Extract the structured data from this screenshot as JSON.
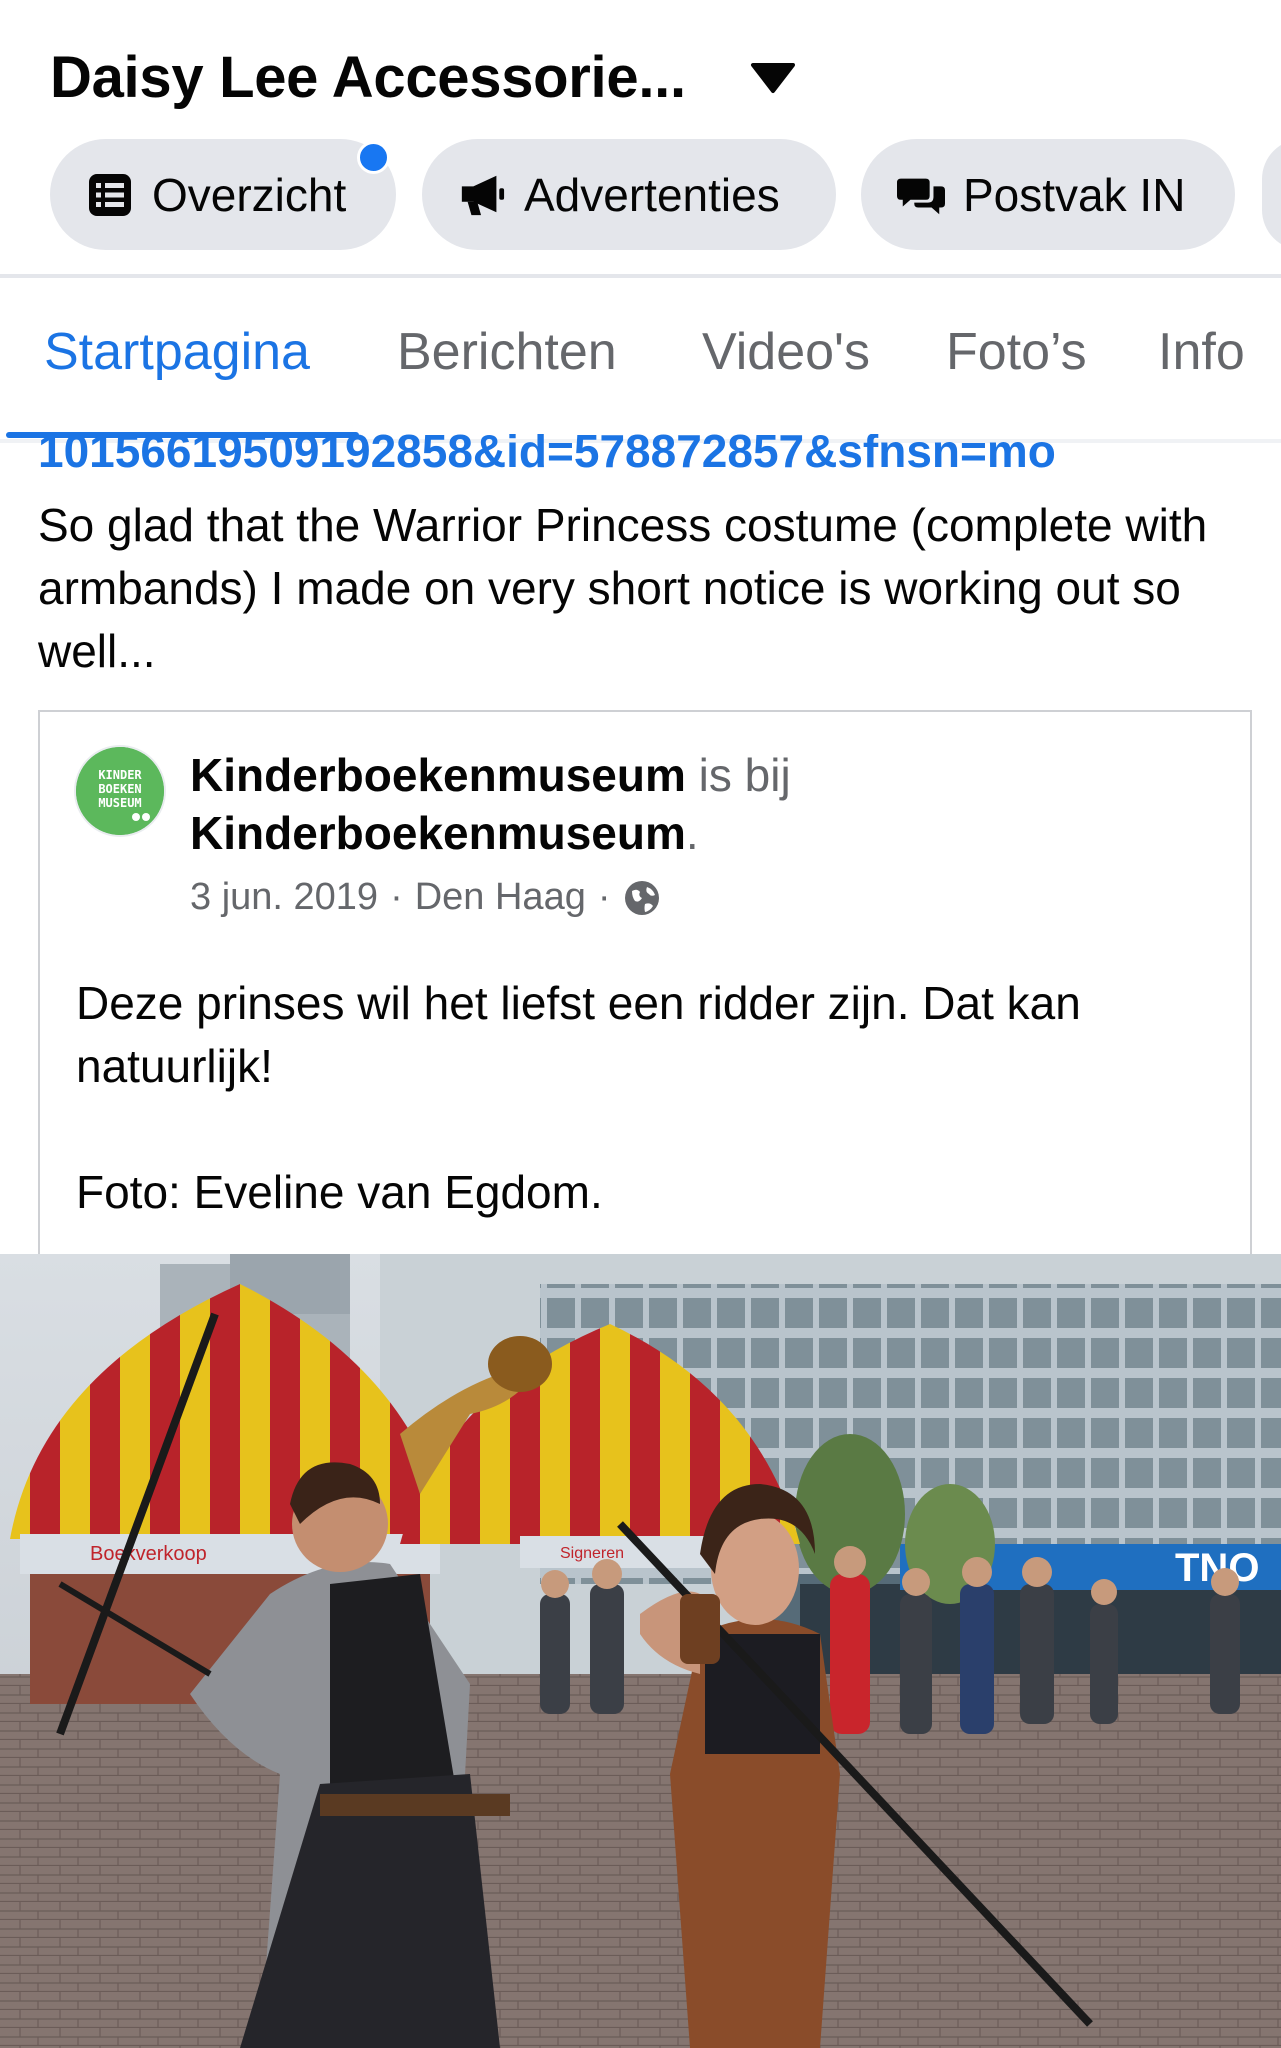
{
  "header": {
    "title": "Daisy Lee Accessorie..."
  },
  "chips": [
    {
      "label": "Overzicht",
      "icon": "list-icon"
    },
    {
      "label": "Advertenties",
      "icon": "megaphone-icon"
    },
    {
      "label": "Postvak IN",
      "icon": "chat-bubbles-icon"
    }
  ],
  "tabs": [
    {
      "label": "Startpagina",
      "active": true
    },
    {
      "label": "Berichten",
      "active": false
    },
    {
      "label": "Video's",
      "active": false
    },
    {
      "label": "Foto’s",
      "active": false
    },
    {
      "label": "Info",
      "active": false
    }
  ],
  "post": {
    "link_text": "10156619509192858&id=578872857&sfnsn=mo",
    "text": "So glad that the Warrior Princess costume (complete with armbands) I made on very short notice is working out so well..."
  },
  "shared": {
    "author": "Kinderboekenmuseum",
    "connector": " is bij ",
    "location_page": "Kinderboekenmuseum",
    "period": ".",
    "date": "3 jun. 2019",
    "place": "Den Haag",
    "separator": "·",
    "privacy_icon": "globe-icon",
    "text_line1": "Deze prinses wil het liefst een ridder zijn. Dat kan natuurlijk!",
    "text_line2": "Foto: Eveline van Egdom.",
    "avatar_text": "KINDER BOEKEN MUSEUM"
  },
  "photo": {
    "sign_left": "Boekverkoop",
    "sign_right": "Signeren",
    "building_sign": "TNO"
  },
  "colors": {
    "accent": "#1b74e4",
    "chip_bg": "#e4e6eb",
    "muted": "#65676b",
    "notification": "#1877f2"
  }
}
